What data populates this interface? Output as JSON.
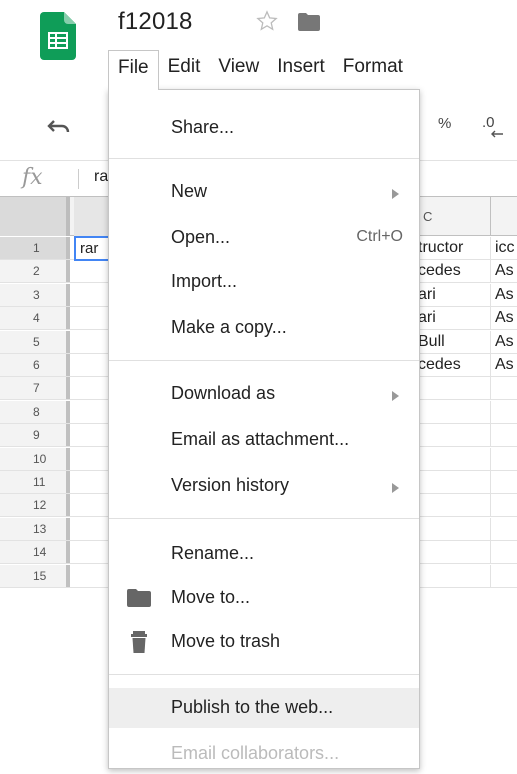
{
  "header": {
    "doc_title": "f12018"
  },
  "menubar": {
    "items": [
      {
        "label": "File"
      },
      {
        "label": "Edit"
      },
      {
        "label": "View"
      },
      {
        "label": "Insert"
      },
      {
        "label": "Format"
      }
    ]
  },
  "toolbar": {
    "percent": "%",
    "decimal": ".0"
  },
  "formula_bar": {
    "fx": "fx",
    "content": "ra"
  },
  "grid": {
    "col_c": "C",
    "rows": [
      {
        "num": "1",
        "a": "rar",
        "c": "tructor",
        "d": "icc"
      },
      {
        "num": "2",
        "a": "",
        "c": "cedes",
        "d": "As"
      },
      {
        "num": "3",
        "a": "",
        "c": "ari",
        "d": "As"
      },
      {
        "num": "4",
        "a": "",
        "c": "ari",
        "d": "As"
      },
      {
        "num": "5",
        "a": "",
        "c": "Bull",
        "d": "As"
      },
      {
        "num": "6",
        "a": "",
        "c": "cedes",
        "d": "As"
      },
      {
        "num": "7",
        "a": "",
        "c": "",
        "d": ""
      },
      {
        "num": "8",
        "a": "",
        "c": "",
        "d": ""
      },
      {
        "num": "9",
        "a": "",
        "c": "",
        "d": ""
      },
      {
        "num": "10",
        "a": "",
        "c": "",
        "d": ""
      },
      {
        "num": "11",
        "a": "",
        "c": "",
        "d": ""
      },
      {
        "num": "12",
        "a": "",
        "c": "",
        "d": ""
      },
      {
        "num": "13",
        "a": "",
        "c": "",
        "d": ""
      },
      {
        "num": "14",
        "a": "",
        "c": "",
        "d": ""
      },
      {
        "num": "15",
        "a": "",
        "c": "",
        "d": ""
      }
    ]
  },
  "file_menu": {
    "share": "Share...",
    "new": "New",
    "open": "Open...",
    "open_shortcut": "Ctrl+O",
    "import": "Import...",
    "make_copy": "Make a copy...",
    "download_as": "Download as",
    "email_attachment": "Email as attachment...",
    "version_history": "Version history",
    "rename": "Rename...",
    "move_to": "Move to...",
    "move_to_trash": "Move to trash",
    "publish": "Publish to the web...",
    "email_collaborators": "Email collaborators..."
  },
  "colors": {
    "sheets_green": "#0f9d58",
    "selection_blue": "#4285f4",
    "hover_gray": "#eeeeee"
  }
}
